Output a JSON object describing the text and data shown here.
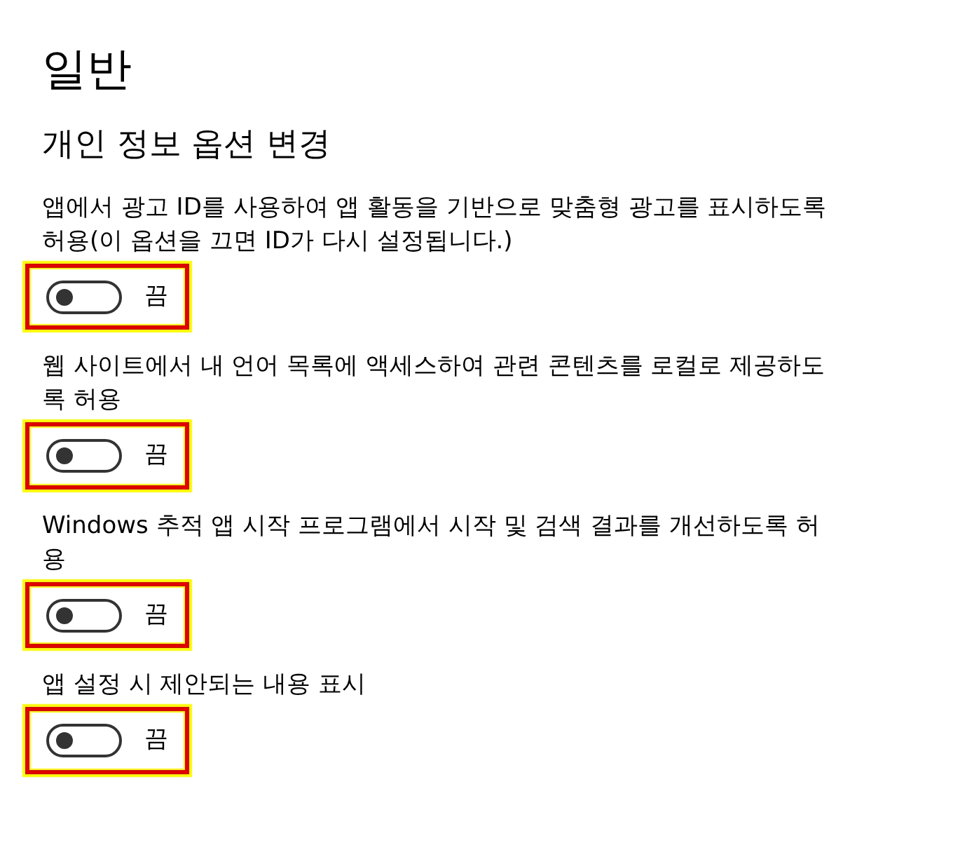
{
  "page_title": "일반",
  "section_heading": "개인 정보 옵션 변경",
  "options": [
    {
      "description": "앱에서 광고 ID를 사용하여 앱 활동을 기반으로 맞춤형 광고를 표시하도록 허용(이 옵션을 끄면 ID가 다시 설정됩니다.)",
      "on": false,
      "state_label": "끔",
      "highlighted": true
    },
    {
      "description": "웹 사이트에서 내 언어 목록에 액세스하여 관련 콘텐츠를 로컬로 제공하도록 허용",
      "on": false,
      "state_label": "끔",
      "highlighted": true
    },
    {
      "description": "Windows 추적 앱 시작 프로그램에서 시작 및 검색 결과를 개선하도록 허용",
      "on": false,
      "state_label": "끔",
      "highlighted": true
    },
    {
      "description": "앱 설정 시 제안되는 내용 표시",
      "on": false,
      "state_label": "끔",
      "highlighted": true
    }
  ]
}
